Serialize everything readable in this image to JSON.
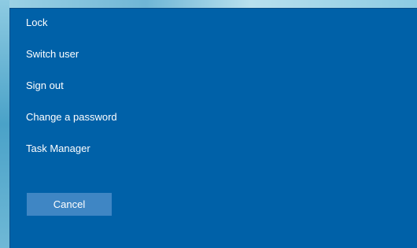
{
  "security_options": {
    "items": [
      {
        "label": "Lock"
      },
      {
        "label": "Switch user"
      },
      {
        "label": "Sign out"
      },
      {
        "label": "Change a password"
      },
      {
        "label": "Task Manager"
      }
    ],
    "cancel_label": "Cancel"
  },
  "colors": {
    "panel_background": "#0061a8",
    "button_background": "#3f86c4",
    "text": "#ffffff"
  }
}
